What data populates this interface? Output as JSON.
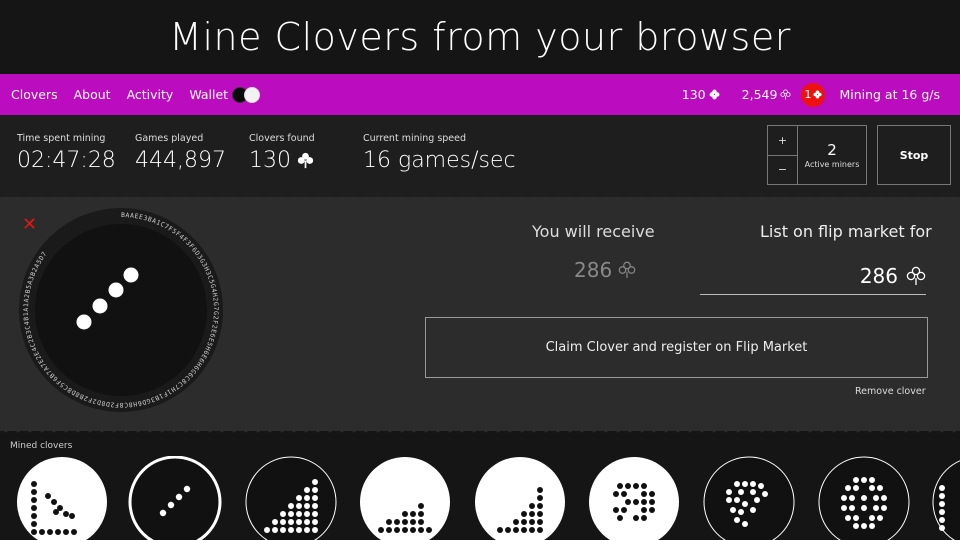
{
  "headline": "Mine Clovers from your browser",
  "nav": {
    "items": [
      "Clovers",
      "About",
      "Activity",
      "Wallet"
    ],
    "clover_count": "130",
    "balance": "2,549",
    "notifications": "1",
    "mining_status": "Mining at 16 g/s"
  },
  "stats": [
    {
      "label": "Time spent mining",
      "value": "02:47:28"
    },
    {
      "label": "Games played",
      "value": "444,897"
    },
    {
      "label": "Clovers found",
      "value": "130"
    },
    {
      "label": "Current mining speed",
      "value": "16 games/sec"
    }
  ],
  "miners": {
    "plus": "+",
    "minus": "−",
    "count": "2",
    "label": "Active miners"
  },
  "stop_label": "Stop",
  "clover_panel": {
    "close": "✕",
    "ring_text": "BAAEE3BA1C7F5F4F3F6D3G3H3C5G4H2G7G2F2E6E5H6E6H6G6C8C7H1F1B3GD6H8C8F2D8D2F2B8D8C5F6B7A7E2E4C2B3C4B1A1A2B5A3B2A5D7",
    "receive_label": "You will receive",
    "receive_value": "286",
    "list_label": "List on flip market for",
    "list_value": "286",
    "claim_label": "Claim Clover and register on Flip Market",
    "remove_label": "Remove clover"
  },
  "mined_label": "Mined clovers",
  "colors": {
    "accent": "#bc0cc0",
    "alert": "#ee1111"
  }
}
